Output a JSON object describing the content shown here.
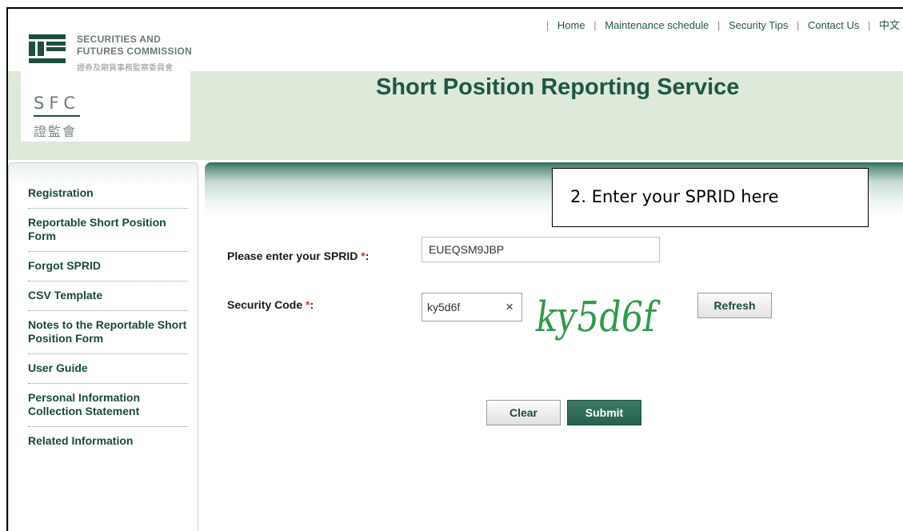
{
  "brand": {
    "org_line1": "SECURITIES AND",
    "org_line2": "FUTURES COMMISSION",
    "org_chinese": "證券及期貨事務監察委員會",
    "abbr": "SFC",
    "abbr_chinese": "證監會"
  },
  "topnav": {
    "items": [
      "Home",
      "Maintenance schedule",
      "Security Tips",
      "Contact Us",
      "中文"
    ]
  },
  "header": {
    "title": "Short Position Reporting Service"
  },
  "sidebar": {
    "items": [
      "Registration",
      "Reportable Short Position Form",
      "Forgot SPRID",
      "CSV Template",
      "Notes to the Reportable Short Position Form",
      "User Guide",
      "Personal Information Collection Statement",
      "Related Information"
    ]
  },
  "callout": {
    "text": "2. Enter your SPRID here"
  },
  "form": {
    "sprid_label": "Please enter your SPRID",
    "sprid_value": "EUEQSM9JBP",
    "security_code_label": "Security Code",
    "required_mark": "*",
    "label_colon": ":",
    "security_code_value": "ky5d6f",
    "clear_glyph": "×",
    "captcha_text": "ky5d6f",
    "refresh_label": "Refresh",
    "clear_label": "Clear",
    "submit_label": "Submit"
  },
  "colors": {
    "brand_green": "#1f5645",
    "header_band": "#dde9d9",
    "submit_bg": "#2f6d59",
    "required": "#e0301e"
  }
}
